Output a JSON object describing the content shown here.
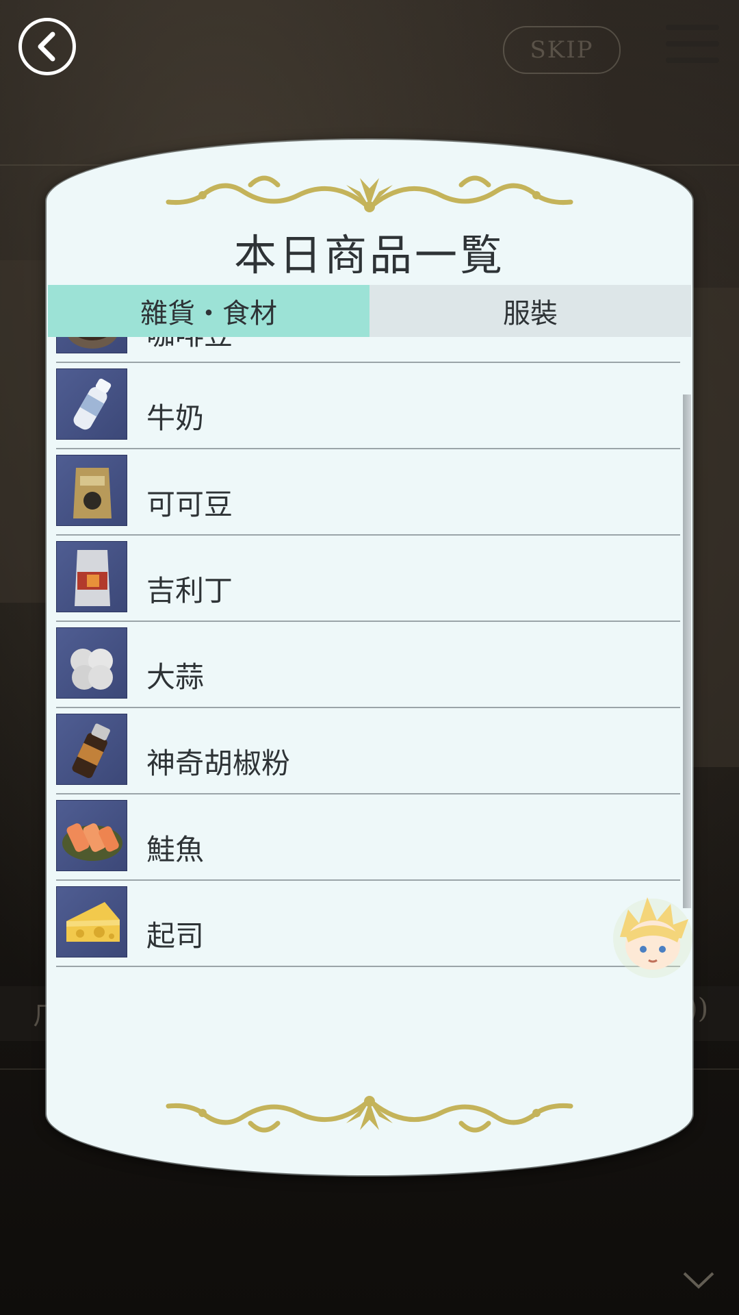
{
  "header": {
    "skip_label": "SKIP"
  },
  "panel": {
    "title": "本日商品一覧",
    "tabs": [
      {
        "label": "雜貨・食材",
        "active": true
      },
      {
        "label": "服裝",
        "active": false
      }
    ],
    "items": [
      {
        "label": "咖啡豆",
        "icon": "coffee-beans-icon"
      },
      {
        "label": "牛奶",
        "icon": "milk-bottle-icon"
      },
      {
        "label": "可可豆",
        "icon": "cocoa-bag-icon"
      },
      {
        "label": "吉利丁",
        "icon": "gelatin-pack-icon"
      },
      {
        "label": "大蒜",
        "icon": "garlic-net-icon"
      },
      {
        "label": "神奇胡椒粉",
        "icon": "pepper-bottle-icon"
      },
      {
        "label": "鮭魚",
        "icon": "salmon-dish-icon"
      },
      {
        "label": "起司",
        "icon": "cheese-icon"
      }
    ]
  },
  "background": {
    "left_text": "ㄏ",
    "right_text": "))"
  },
  "colors": {
    "panel_bg": "#eef8f9",
    "tab_active": "#9ce2d6",
    "tab_inactive": "#dde6e8",
    "ornament": "#c4b35a",
    "thumb_bg": "#4f5d92"
  }
}
